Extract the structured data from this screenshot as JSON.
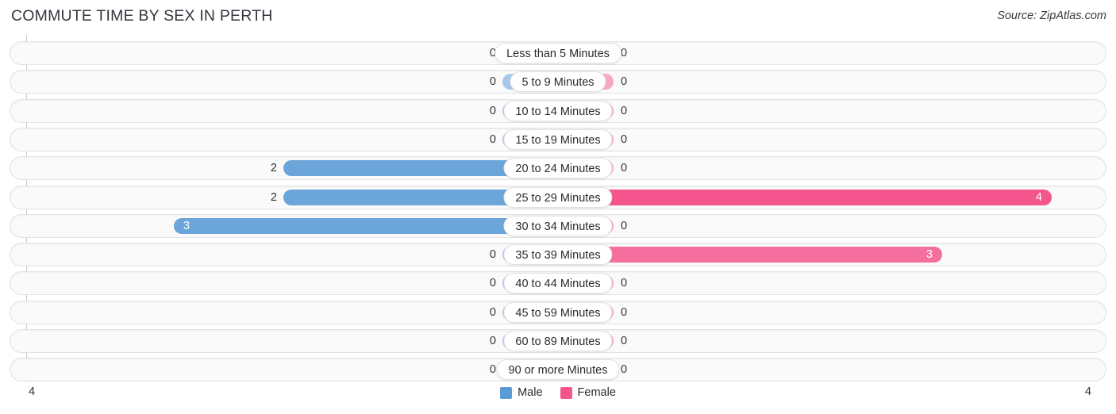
{
  "header": {
    "title": "COMMUTE TIME BY SEX IN PERTH",
    "source": "Source: ZipAtlas.com"
  },
  "legend": {
    "male_label": "Male",
    "female_label": "Female",
    "male_color": "#5b9bd5",
    "female_color": "#f4558c"
  },
  "axis": {
    "left_end": "4",
    "right_end": "4"
  },
  "chart_data": {
    "type": "bar",
    "title": "COMMUTE TIME BY SEX IN PERTH",
    "subtitle": "",
    "orientation": "horizontal-diverging",
    "xlabel": "",
    "ylabel": "",
    "xlim": [
      0,
      4
    ],
    "grid": false,
    "legend_position": "bottom-center",
    "categories": [
      "Less than 5 Minutes",
      "5 to 9 Minutes",
      "10 to 14 Minutes",
      "15 to 19 Minutes",
      "20 to 24 Minutes",
      "25 to 29 Minutes",
      "30 to 34 Minutes",
      "35 to 39 Minutes",
      "40 to 44 Minutes",
      "45 to 59 Minutes",
      "60 to 89 Minutes",
      "90 or more Minutes"
    ],
    "series": [
      {
        "name": "Male",
        "values": [
          0,
          0,
          0,
          0,
          2,
          2,
          3,
          0,
          0,
          0,
          0,
          0
        ]
      },
      {
        "name": "Female",
        "values": [
          0,
          0,
          0,
          0,
          0,
          4,
          0,
          3,
          0,
          0,
          0,
          0
        ]
      }
    ]
  },
  "rows": [
    {
      "category": "Less than 5 Minutes",
      "male": "0",
      "female": "0"
    },
    {
      "category": "5 to 9 Minutes",
      "male": "0",
      "female": "0"
    },
    {
      "category": "10 to 14 Minutes",
      "male": "0",
      "female": "0"
    },
    {
      "category": "15 to 19 Minutes",
      "male": "0",
      "female": "0"
    },
    {
      "category": "20 to 24 Minutes",
      "male": "2",
      "female": "0"
    },
    {
      "category": "25 to 29 Minutes",
      "male": "2",
      "female": "4"
    },
    {
      "category": "30 to 34 Minutes",
      "male": "3",
      "female": "0"
    },
    {
      "category": "35 to 39 Minutes",
      "male": "0",
      "female": "3"
    },
    {
      "category": "40 to 44 Minutes",
      "male": "0",
      "female": "0"
    },
    {
      "category": "45 to 59 Minutes",
      "male": "0",
      "female": "0"
    },
    {
      "category": "60 to 89 Minutes",
      "male": "0",
      "female": "0"
    },
    {
      "category": "90 or more Minutes",
      "male": "0",
      "female": "0"
    }
  ]
}
